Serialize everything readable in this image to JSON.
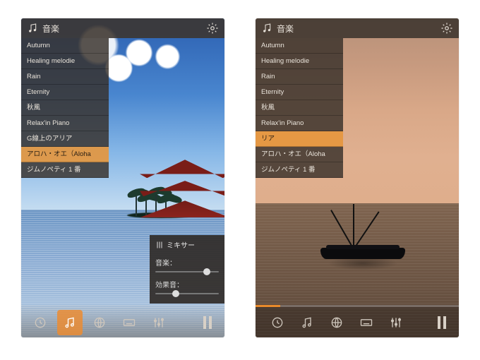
{
  "screens": [
    {
      "header": {
        "title": "音楽"
      },
      "tracks": [
        {
          "label": "Autumn",
          "selected": false
        },
        {
          "label": "Healing melodie",
          "selected": false
        },
        {
          "label": "Rain",
          "selected": false
        },
        {
          "label": "Eternity",
          "selected": false
        },
        {
          "label": "秋風",
          "selected": false
        },
        {
          "label": "Relax'in Piano",
          "selected": false
        },
        {
          "label": "G線上のアリア",
          "selected": false
        },
        {
          "label": "アロハ・オエ（Aloha",
          "selected": true
        },
        {
          "label": "ジムノペティ 1 番",
          "selected": false
        }
      ],
      "mixer": {
        "title": "ミキサー",
        "rows": [
          {
            "label": "音楽：",
            "value": 0.85
          },
          {
            "label": "効果音：",
            "value": 0.3
          }
        ]
      },
      "progress": 0.0,
      "nav_active_index": 1
    },
    {
      "header": {
        "title": "音楽"
      },
      "tracks": [
        {
          "label": "Autumn",
          "selected": false
        },
        {
          "label": "Healing melodie",
          "selected": false
        },
        {
          "label": "Rain",
          "selected": false
        },
        {
          "label": "Eternity",
          "selected": false
        },
        {
          "label": "秋風",
          "selected": false
        },
        {
          "label": "Relax'in Piano",
          "selected": false
        },
        {
          "label": "リア",
          "selected": true
        },
        {
          "label": "アロハ・オエ（Aloha",
          "selected": false
        },
        {
          "label": "ジムノペティ 1 番",
          "selected": false
        }
      ],
      "progress": 0.12,
      "nav_active_index": -1
    }
  ],
  "nav_icons": [
    "clock-icon",
    "music-icon",
    "globe-icon",
    "keyboard-icon",
    "equalizer-icon"
  ],
  "colors": {
    "accent": "#e88a2b",
    "panel": "rgba(55,48,42,.82)"
  }
}
